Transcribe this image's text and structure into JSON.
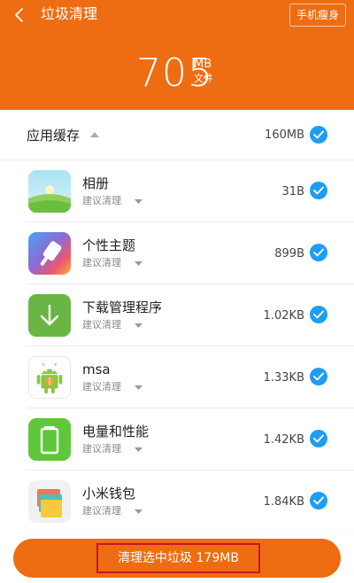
{
  "header": {
    "title": "垃圾清理",
    "slim_button": "手机瘦身",
    "total_value": "705",
    "total_unit": "MB",
    "total_label": "文件",
    "background_color": "#ee6c12"
  },
  "section": {
    "title": "应用缓存",
    "size": "160MB",
    "expanded_icon": "caret-up-icon"
  },
  "items": [
    {
      "name": "相册",
      "sub": "建议清理",
      "size": "31B",
      "icon": "gallery-icon",
      "checked": true
    },
    {
      "name": "个性主题",
      "sub": "建议清理",
      "size": "899B",
      "icon": "themes-icon",
      "checked": true
    },
    {
      "name": "下载管理程序",
      "sub": "建议清理",
      "size": "1.02KB",
      "icon": "download-icon",
      "checked": true
    },
    {
      "name": "msa",
      "sub": "建议清理",
      "size": "1.33KB",
      "icon": "android-icon",
      "checked": true
    },
    {
      "name": "电量和性能",
      "sub": "建议清理",
      "size": "1.42KB",
      "icon": "battery-icon",
      "checked": true
    },
    {
      "name": "小米钱包",
      "sub": "建议清理",
      "size": "1.84KB",
      "icon": "wallet-icon",
      "checked": true
    }
  ],
  "bottom": {
    "clean_button": "清理选中垃圾 179MB"
  },
  "colors": {
    "accent": "#ee6c12",
    "check": "#1f9df3",
    "highlight_border": "#c8171d"
  }
}
